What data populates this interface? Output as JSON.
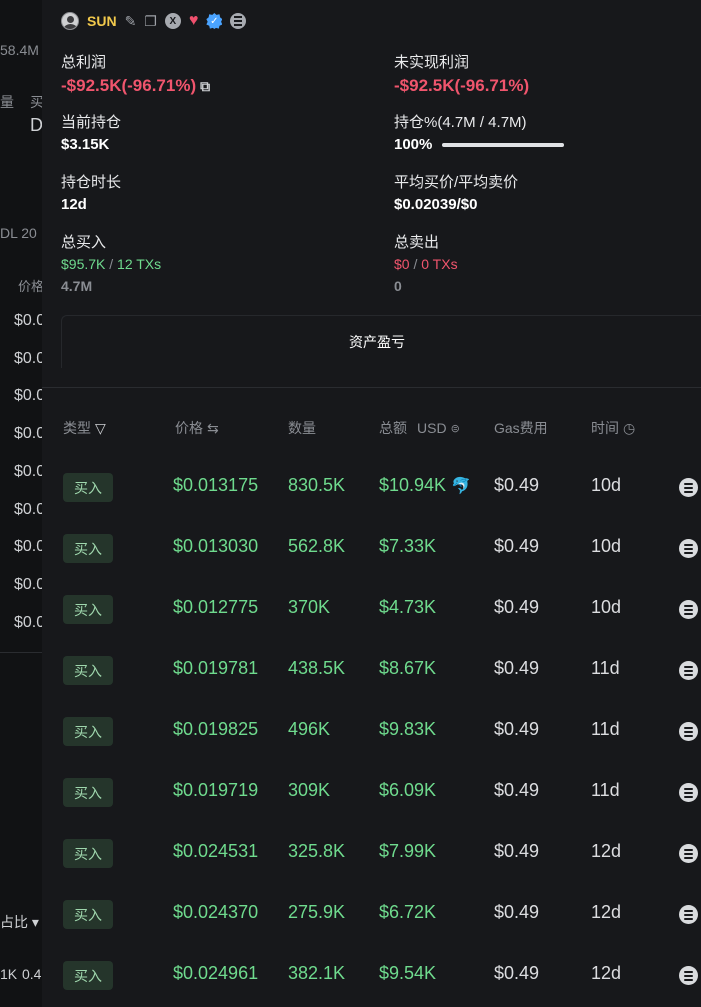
{
  "background_left": {
    "items": [
      "58.4M",
      "量",
      "买",
      "D",
      "DL 20",
      "价格",
      "占比 ▾",
      "1K",
      "0.4"
    ],
    "price_rows": [
      "$0.0",
      "$0.0",
      "$0.0",
      "$0.0",
      "$0.0",
      "$0.0",
      "$0.0",
      "$0.0",
      "$0.0"
    ]
  },
  "header": {
    "username": "SUN",
    "x_icon_text": "X",
    "verify_text": "✓"
  },
  "stats": {
    "total_profit": {
      "label": "总利润",
      "value": "-$92.5K(-96.71%)"
    },
    "unrealized_profit": {
      "label": "未实现利润",
      "value": "-$92.5K(-96.71%)"
    },
    "current_holdings": {
      "label": "当前持仓",
      "value": "$3.15K"
    },
    "holding_pct": {
      "label": "持仓%(4.7M / 4.7M)",
      "value": "100%",
      "fill": 1.0
    },
    "hold_duration": {
      "label": "持仓时长",
      "value": "12d"
    },
    "avg_price": {
      "label": "平均买价/平均卖价",
      "value": "$0.02039/$0"
    },
    "total_buy": {
      "label": "总买入",
      "amount": "$95.7K",
      "sep": "/",
      "txs": "12 TXs",
      "tokens": "4.7M"
    },
    "total_sell": {
      "label": "总卖出",
      "amount": "$0",
      "sep": "/",
      "txs": "0 TXs",
      "tokens": "0"
    }
  },
  "pnl_tab": {
    "label": "资产盈亏"
  },
  "table": {
    "headers": {
      "type": "类型",
      "price": "价格",
      "amount": "数量",
      "total": "总额",
      "usd": "USD",
      "gas": "Gas费用",
      "time": "时间"
    },
    "rows": [
      {
        "type": "买入",
        "price": "$0.013175",
        "qty": "830.5K",
        "total": "$10.94K",
        "whale": "🐬",
        "gas": "$0.49",
        "time": "10d"
      },
      {
        "type": "买入",
        "price": "$0.013030",
        "qty": "562.8K",
        "total": "$7.33K",
        "whale": "",
        "gas": "$0.49",
        "time": "10d"
      },
      {
        "type": "买入",
        "price": "$0.012775",
        "qty": "370K",
        "total": "$4.73K",
        "whale": "",
        "gas": "$0.49",
        "time": "10d"
      },
      {
        "type": "买入",
        "price": "$0.019781",
        "qty": "438.5K",
        "total": "$8.67K",
        "whale": "",
        "gas": "$0.49",
        "time": "11d"
      },
      {
        "type": "买入",
        "price": "$0.019825",
        "qty": "496K",
        "total": "$9.83K",
        "whale": "",
        "gas": "$0.49",
        "time": "11d"
      },
      {
        "type": "买入",
        "price": "$0.019719",
        "qty": "309K",
        "total": "$6.09K",
        "whale": "",
        "gas": "$0.49",
        "time": "11d"
      },
      {
        "type": "买入",
        "price": "$0.024531",
        "qty": "325.8K",
        "total": "$7.99K",
        "whale": "",
        "gas": "$0.49",
        "time": "12d"
      },
      {
        "type": "买入",
        "price": "$0.024370",
        "qty": "275.9K",
        "total": "$6.72K",
        "whale": "",
        "gas": "$0.49",
        "time": "12d"
      },
      {
        "type": "买入",
        "price": "$0.024961",
        "qty": "382.1K",
        "total": "$9.54K",
        "whale": "",
        "gas": "$0.49",
        "time": "12d"
      }
    ]
  },
  "colors": {
    "buy_green": "#6fdb8e",
    "loss_red": "#f0556d",
    "accent_gold": "#f2c94c",
    "panel_bg": "#17181b"
  }
}
